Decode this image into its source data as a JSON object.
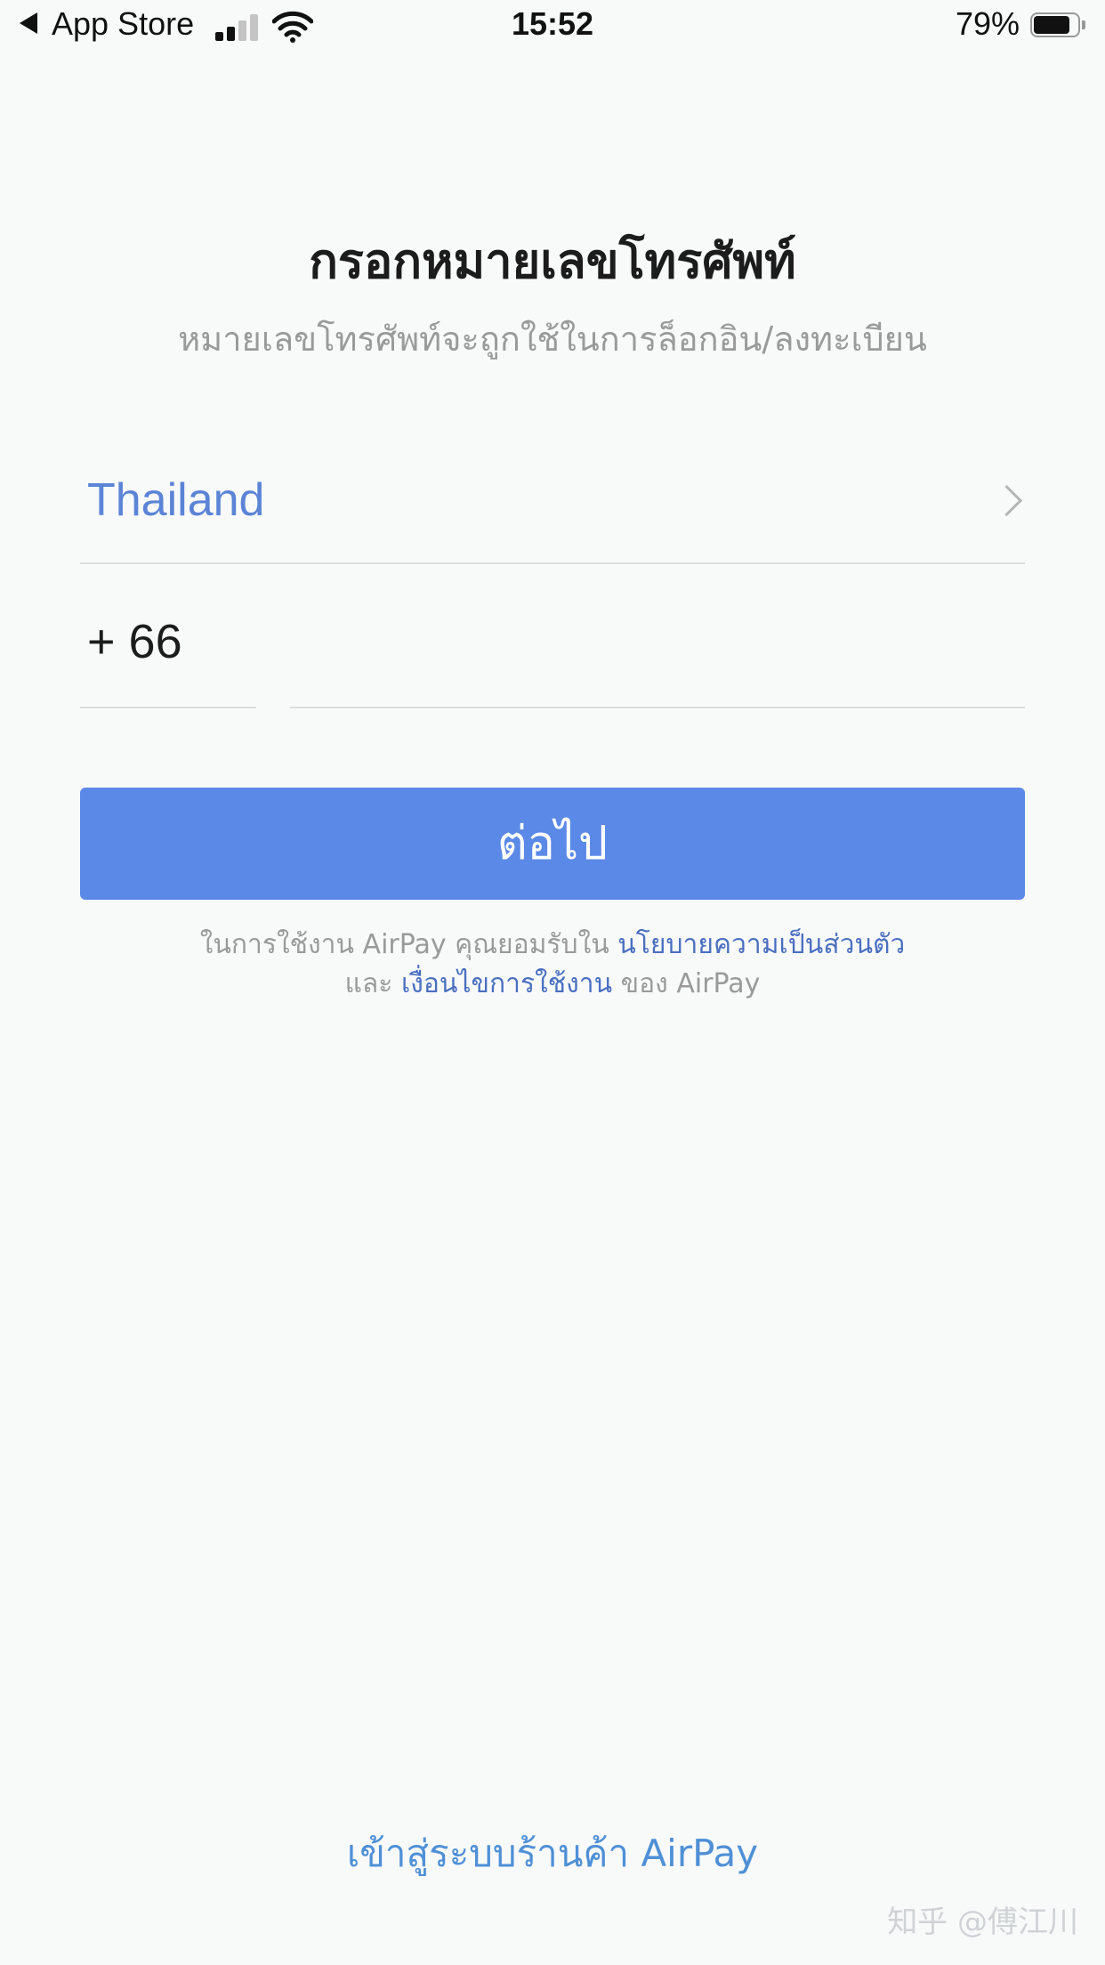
{
  "status_bar": {
    "back_app": "App Store",
    "time": "15:52",
    "battery_percent": "79%",
    "battery_level": 0.79,
    "signal_bars_filled": 2,
    "signal_bars_total": 4
  },
  "header": {
    "title": "กรอกหมายเลขโทรศัพท์",
    "subtitle": "หมายเลขโทรศัพท์จะถูกใช้ในการล็อกอิน/ลงทะเบียน"
  },
  "form": {
    "country": "Thailand",
    "country_code": "+ 66",
    "phone_value": "",
    "next_label": "ต่อไป"
  },
  "terms": {
    "prefix": "ในการใช้งาน AirPay คุณยอมรับใน ",
    "privacy_link": "นโยบายความเป็นส่วนตัว",
    "and_text": "และ ",
    "conditions_link": "เงื่อนไขการใช้งาน",
    "suffix": " ของ AirPay"
  },
  "footer": {
    "merchant_link": "เข้าสู่ระบบร้านค้า AirPay",
    "watermark": "知乎 @傅江川"
  },
  "colors": {
    "accent": "#5b89e7",
    "link": "#4a6fc0",
    "country_text": "#5b84d6",
    "background": "#f8fafa"
  }
}
